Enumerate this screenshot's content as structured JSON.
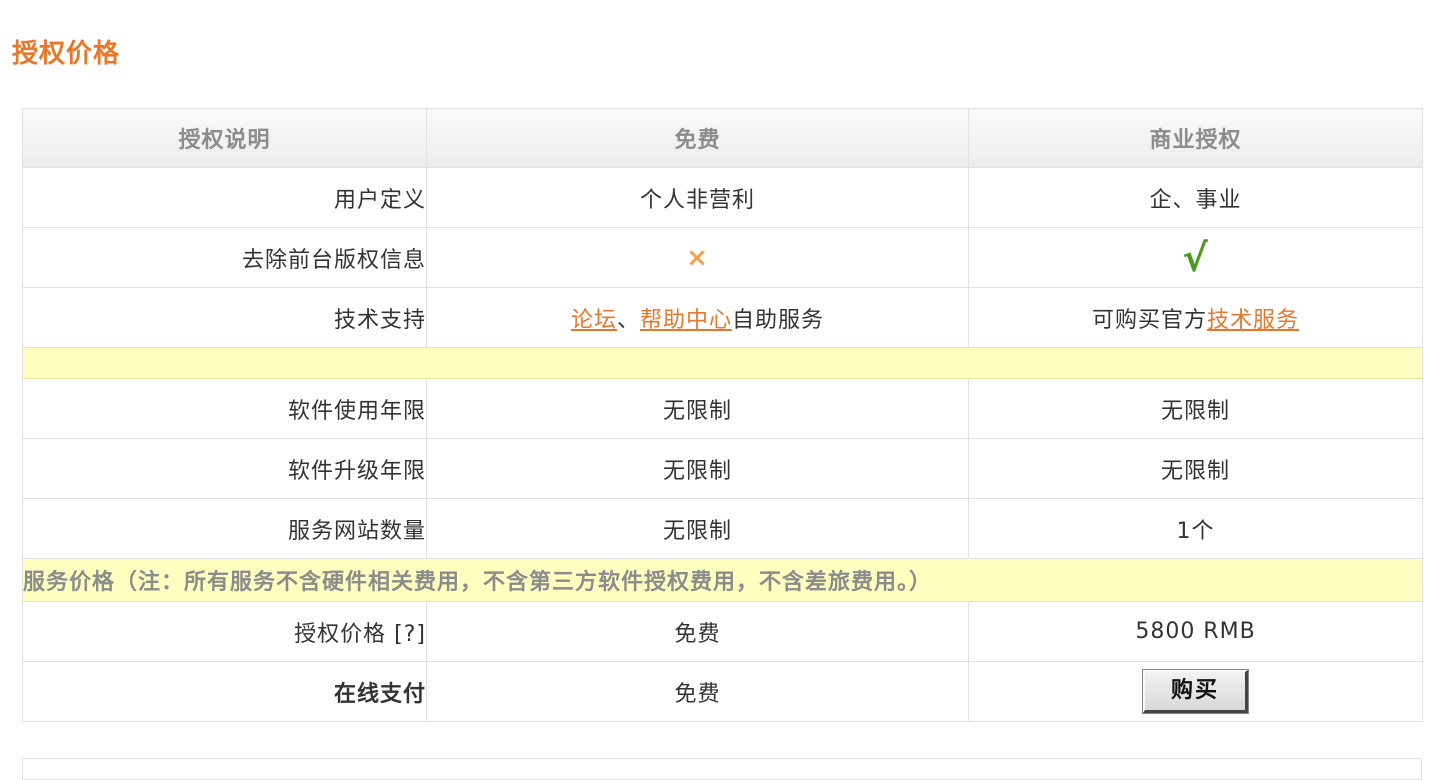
{
  "page": {
    "title": "授权价格"
  },
  "table": {
    "headers": [
      "授权说明",
      "免费",
      "商业授权"
    ],
    "rows": {
      "user": {
        "label": "用户定义",
        "free": "个人非营利",
        "commercial": "企、事业"
      },
      "copyright": {
        "label": "去除前台版权信息",
        "free_icon": "×",
        "commercial_icon": "√"
      },
      "support": {
        "label": "技术支持",
        "free_link1": "论坛",
        "free_sep": "、",
        "free_link2": "帮助中心",
        "free_suffix": "自助服务",
        "commercial_prefix": "可购买官方",
        "commercial_link": "技术服务"
      },
      "use_years": {
        "label": "软件使用年限",
        "free": "无限制",
        "commercial": "无限制"
      },
      "upgrade_years": {
        "label": "软件升级年限",
        "free": "无限制",
        "commercial": "无限制"
      },
      "sites": {
        "label": "服务网站数量",
        "free": "无限制",
        "commercial": "1个"
      },
      "service_note": "服务价格（注：所有服务不含硬件相关费用，不含第三方软件授权费用，不含差旅费用。）",
      "price": {
        "label": "授权价格 [?]",
        "free": "免费",
        "commercial": "5800 RMB"
      },
      "online_pay": {
        "label": "在线支付",
        "free": "免费",
        "buy_label": "购买"
      }
    }
  },
  "colors": {
    "accent": "#e8772c",
    "highlight_row": "#ffffbf",
    "check": "#4a9a1e",
    "cross": "#f0a050"
  }
}
